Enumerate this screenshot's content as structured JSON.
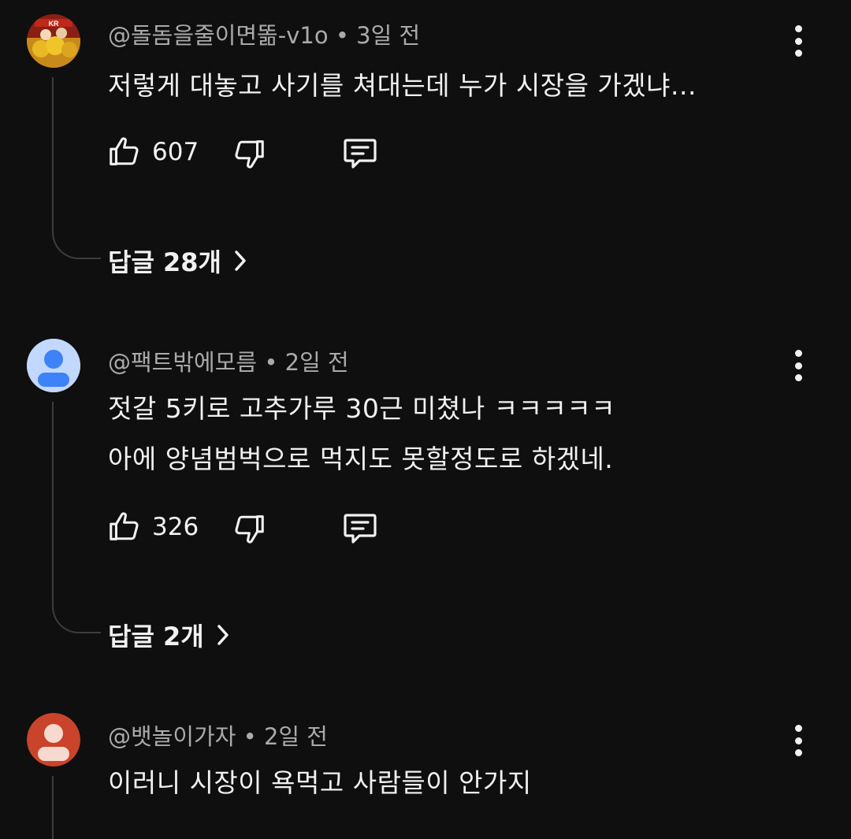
{
  "comments": [
    {
      "author": "@돌돔을줄이면똚-v1o",
      "time": "3일 전",
      "lines": [
        "저렇게 대놓고 사기를 쳐대는데 누가 시장을 가겠냐..."
      ],
      "likes": "607",
      "replies_label": "답글 28개",
      "avatar": "photo-avatar"
    },
    {
      "author": "@팩트밖에모름",
      "time": "2일 전",
      "lines": [
        "젓갈 5키로 고추가루 30근 미쳤나 ㅋㅋㅋㅋㅋ",
        "아에 양념범벅으로 먹지도 못할정도로 하겠네."
      ],
      "likes": "326",
      "replies_label": "답글 2개",
      "avatar": "default-avatar",
      "avatar_color": "#3e82f7",
      "avatar_bg": "#c2d8ff"
    },
    {
      "author": "@뱃놀이가자",
      "time": "2일 전",
      "lines": [
        "이러니 시장이 욕먹고 사람들이 안가지"
      ],
      "avatar": "default-avatar",
      "avatar_color": "#f8d9cf",
      "avatar_bg": "#c9442a"
    }
  ],
  "separator": "•"
}
